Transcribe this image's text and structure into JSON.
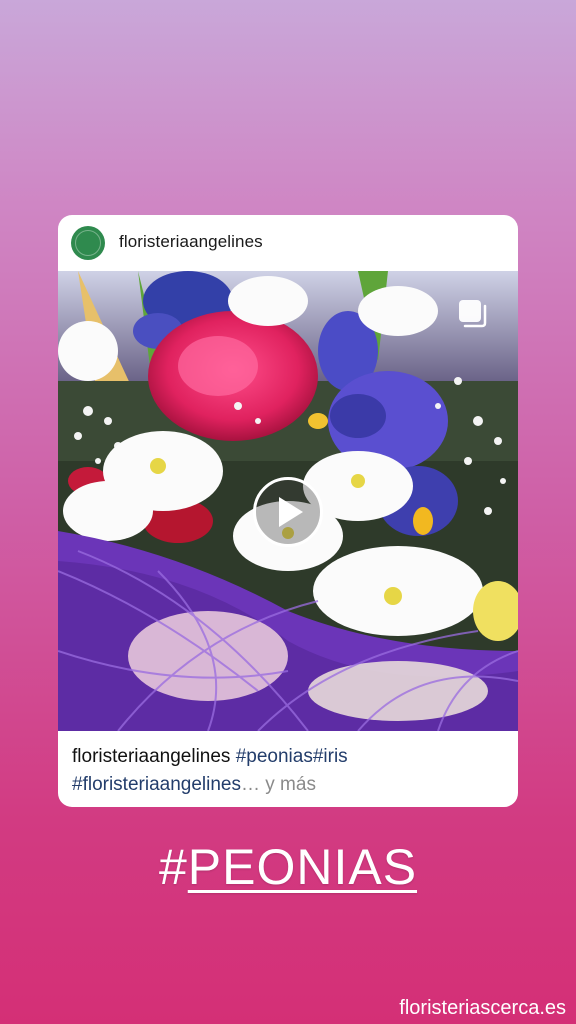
{
  "post": {
    "username": "floristeriaangelines",
    "caption_user": "floristeriaangelines",
    "caption_tags_line1": "#peonias#iris",
    "caption_tags_line2": "#floristeriaangelines",
    "caption_ellipsis": "… ",
    "caption_more": "y más"
  },
  "sticker": {
    "hash": "#",
    "word": "PEONIAS"
  },
  "watermark": "floristeriascerca.es",
  "icons": [
    "avatar",
    "multi-post-icon",
    "play-icon"
  ],
  "colors": {
    "background_top": "#c9a7d9",
    "background_bottom": "#d42f76",
    "tag_text": "#233d6b",
    "more_text": "#8a8a8a"
  }
}
